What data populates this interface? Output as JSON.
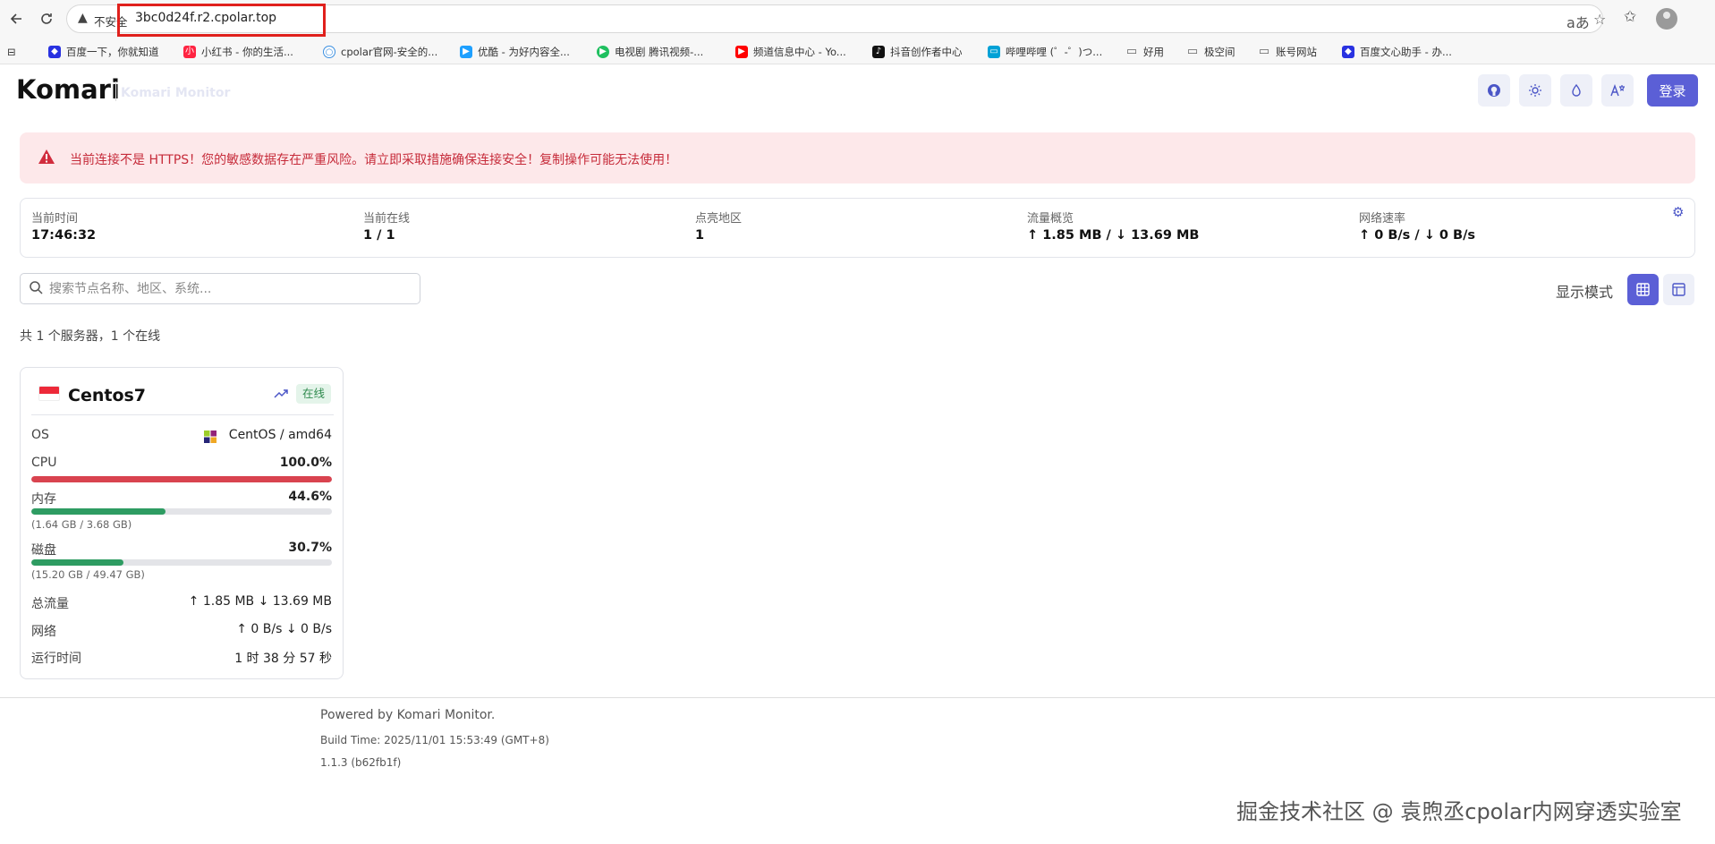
{
  "browser": {
    "address_warning": "不安全",
    "url": "3bc0d24f.r2.cpolar.top",
    "bookmarks": [
      {
        "label": "百度一下，你就知道",
        "icon": "baidu-icon",
        "color": "#2932e1"
      },
      {
        "label": "小红书 - 你的生活...",
        "icon": "xiaohongshu-icon",
        "color": "#ff2442"
      },
      {
        "label": "cpolar官网-安全的...",
        "icon": "search-icon",
        "color": "#3b8fe0"
      },
      {
        "label": "优酷 - 为好内容全...",
        "icon": "youku-icon",
        "color": "#1ea0ff"
      },
      {
        "label": "电视剧 腾讯视频-...",
        "icon": "tencent-video-icon",
        "color": "#20c060"
      },
      {
        "label": "频道信息中心 - Yo...",
        "icon": "youtube-icon",
        "color": "#ff0000"
      },
      {
        "label": "抖音创作者中心",
        "icon": "douyin-icon",
        "color": "#111111"
      },
      {
        "label": "哔哩哔哩 (゜-゜)つ...",
        "icon": "bilibili-icon",
        "color": "#00a1d6"
      },
      {
        "label": "好用",
        "icon": "folder-icon",
        "color": "#666666"
      },
      {
        "label": "极空间",
        "icon": "folder-icon",
        "color": "#666666"
      },
      {
        "label": "账号网站",
        "icon": "folder-icon",
        "color": "#666666"
      },
      {
        "label": "百度文心助手 - 办...",
        "icon": "baidu-icon",
        "color": "#2932e1"
      }
    ]
  },
  "header": {
    "title": "Komari",
    "subtitle": "Komari Monitor",
    "login_label": "登录",
    "buttons": [
      "github-icon",
      "sun-icon",
      "palette-icon",
      "translate-icon"
    ]
  },
  "alert": {
    "text": "当前连接不是 HTTPS！您的敏感数据存在严重风险。请立即采取措施确保连接安全！复制操作可能无法使用！"
  },
  "stats": [
    {
      "label": "当前时间",
      "value": "17:46:32"
    },
    {
      "label": "当前在线",
      "value": "1 / 1"
    },
    {
      "label": "点亮地区",
      "value": "1"
    },
    {
      "label": "流量概览",
      "value": "↑ 1.85 MB / ↓ 13.69 MB"
    },
    {
      "label": "网络速率",
      "value": "↑ 0 B/s / ↓ 0 B/s"
    }
  ],
  "search": {
    "placeholder": "搜索节点名称、地区、系统..."
  },
  "view_mode": {
    "label": "显示模式"
  },
  "summary": {
    "text": "共 1 个服务器，1 个在线"
  },
  "server": {
    "name": "Centos7",
    "status": "在线",
    "os_label": "OS",
    "os_value": "CentOS / amd64",
    "cpu_label": "CPU",
    "cpu_value": "100.0%",
    "cpu_fraction": 1.0,
    "mem_label": "内存",
    "mem_value": "44.6%",
    "mem_fraction": 0.446,
    "mem_detail": "(1.64 GB / 3.68 GB)",
    "disk_label": "磁盘",
    "disk_value": "30.7%",
    "disk_fraction": 0.307,
    "disk_detail": "(15.20 GB / 49.47 GB)",
    "traffic_label": "总流量",
    "traffic_value": "↑ 1.85 MB ↓ 13.69 MB",
    "net_label": "网络",
    "net_value": "↑ 0 B/s ↓ 0 B/s",
    "uptime_label": "运行时间",
    "uptime_value": "1 时 38 分 57 秒",
    "colors": {
      "cpu": "#d9434f",
      "mem": "#2e9c62",
      "disk": "#2e9c62"
    }
  },
  "footer": {
    "powered": "Powered by Komari Monitor.",
    "build": "Build Time: 2025/11/01 15:53:49 (GMT+8)",
    "version": "1.1.3 (b62fb1f)"
  },
  "watermark": "掘金技术社区 @ 袁煦丞cpolar内网穿透实验室"
}
